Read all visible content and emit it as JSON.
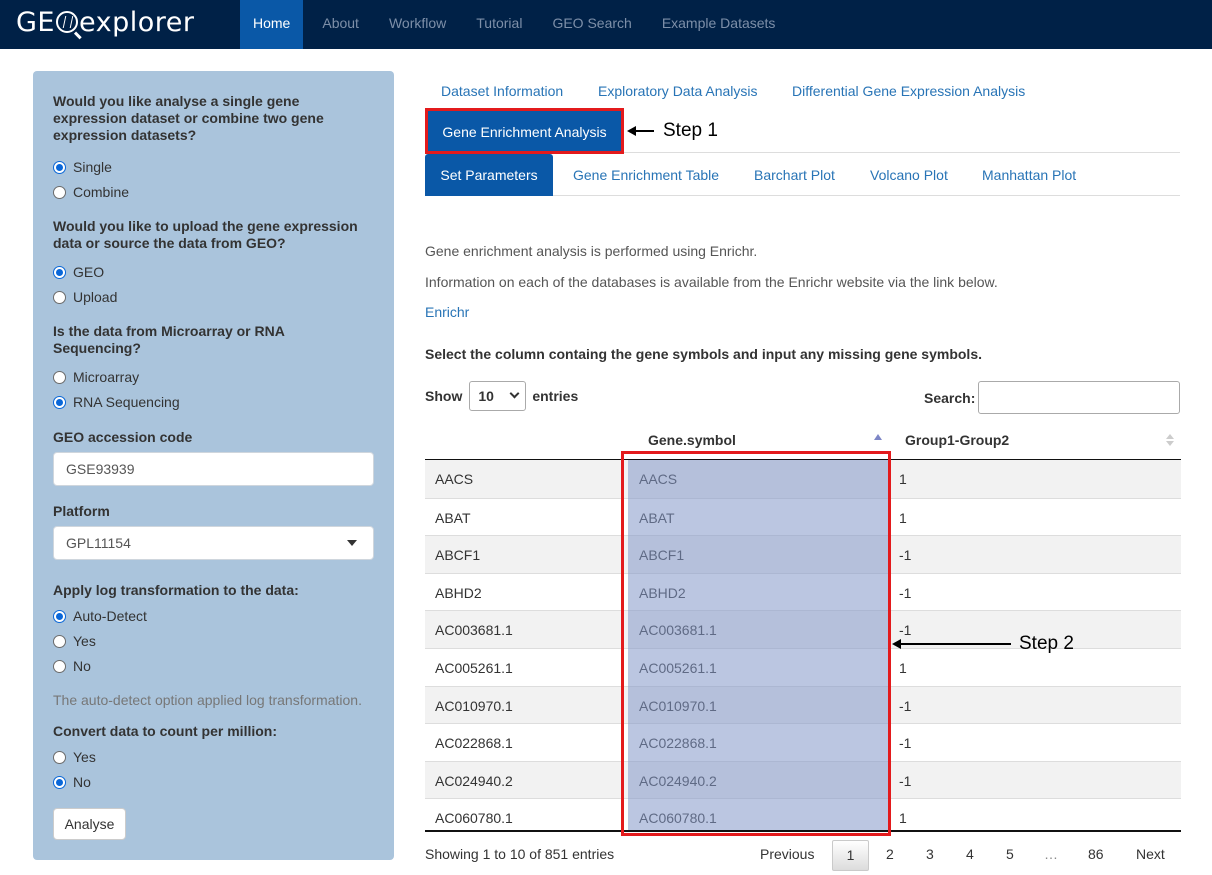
{
  "app": {
    "brand": {
      "left": "GE",
      "right": "explorer"
    }
  },
  "nav": [
    "Home",
    "About",
    "Workflow",
    "Tutorial",
    "GEO Search",
    "Example Datasets"
  ],
  "sidebar": {
    "q1": "Would you like analyse a single gene expression dataset or combine two gene expression datasets?",
    "q1_options": [
      "Single",
      "Combine"
    ],
    "q2": "Would you like to upload the gene expression data or source the data from GEO?",
    "q2_options": [
      "GEO",
      "Upload"
    ],
    "q3": "Is the data from Microarray or RNA Sequencing?",
    "q3_options": [
      "Microarray",
      "RNA Sequencing"
    ],
    "geo_label": "GEO accession code",
    "geo_value": "GSE93939",
    "platform_label": "Platform",
    "platform_value": "GPL11154",
    "log_label": "Apply log transformation to the data:",
    "log_options": [
      "Auto-Detect",
      "Yes",
      "No"
    ],
    "log_help": "The auto-detect option applied log transformation.",
    "cpm_label": "Convert data to count per million:",
    "cpm_options": [
      "Yes",
      "No"
    ],
    "analyse": "Analyse"
  },
  "main_tabs": {
    "row1": [
      "Dataset Information",
      "Exploratory Data Analysis",
      "Differential Gene Expression Analysis"
    ],
    "active": "Gene Enrichment Analysis",
    "sub_active": "Set Parameters",
    "sub": [
      "Gene Enrichment Table",
      "Barchart Plot",
      "Volcano Plot",
      "Manhattan Plot"
    ]
  },
  "annotations": {
    "step1": "Step 1",
    "step2": "Step 2"
  },
  "content": {
    "p1": "Gene enrichment analysis is performed using Enrichr.",
    "p2": "Information on each of the databases is available from the Enrichr website via the link below.",
    "link": "Enrichr",
    "instruction": "Select the column containg the gene symbols and input any missing gene symbols.",
    "show": "Show",
    "show_value": "10",
    "entries": "entries",
    "search": "Search:"
  },
  "table": {
    "headers": [
      "",
      "Gene.symbol",
      "Group1-Group2"
    ],
    "rows": [
      [
        "AACS",
        "AACS",
        "1"
      ],
      [
        "ABAT",
        "ABAT",
        "1"
      ],
      [
        "ABCF1",
        "ABCF1",
        "-1"
      ],
      [
        "ABHD2",
        "ABHD2",
        "-1"
      ],
      [
        "AC003681.1",
        "AC003681.1",
        "-1"
      ],
      [
        "AC005261.1",
        "AC005261.1",
        "1"
      ],
      [
        "AC010970.1",
        "AC010970.1",
        "-1"
      ],
      [
        "AC022868.1",
        "AC022868.1",
        "-1"
      ],
      [
        "AC024940.2",
        "AC024940.2",
        "-1"
      ],
      [
        "AC060780.1",
        "AC060780.1",
        "1"
      ]
    ],
    "info": "Showing 1 to 10 of 851 entries",
    "pager": {
      "previous": "Previous",
      "pages": [
        "1",
        "2",
        "3",
        "4",
        "5",
        "…",
        "86"
      ],
      "next": "Next"
    }
  }
}
